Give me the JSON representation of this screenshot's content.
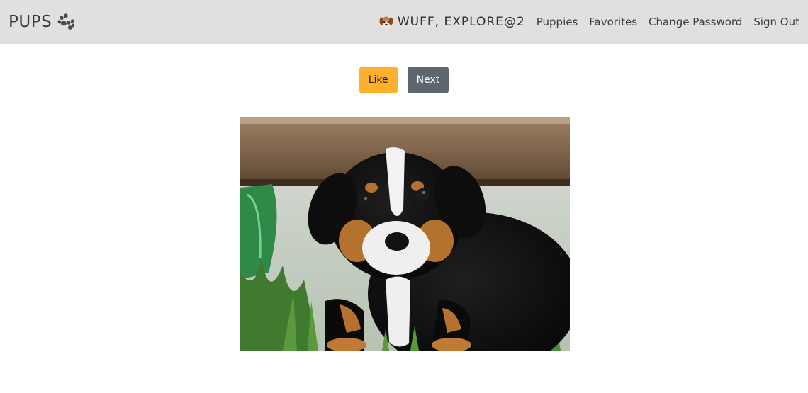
{
  "navbar": {
    "brand": "PUPS",
    "brand_icon": "paw-icon",
    "greeting_icon": "puppy-face-icon",
    "greeting": "WUFF, EXPLORE@2",
    "links": [
      "Puppies",
      "Favorites",
      "Change Password",
      "Sign Out"
    ]
  },
  "actions": {
    "like_label": "Like",
    "next_label": "Next"
  },
  "photo": {
    "subject": "puppy-photo"
  },
  "colors": {
    "navbar_bg": "#e0e0e0",
    "like_button": "#fcb02b",
    "next_button": "#5e666e"
  }
}
